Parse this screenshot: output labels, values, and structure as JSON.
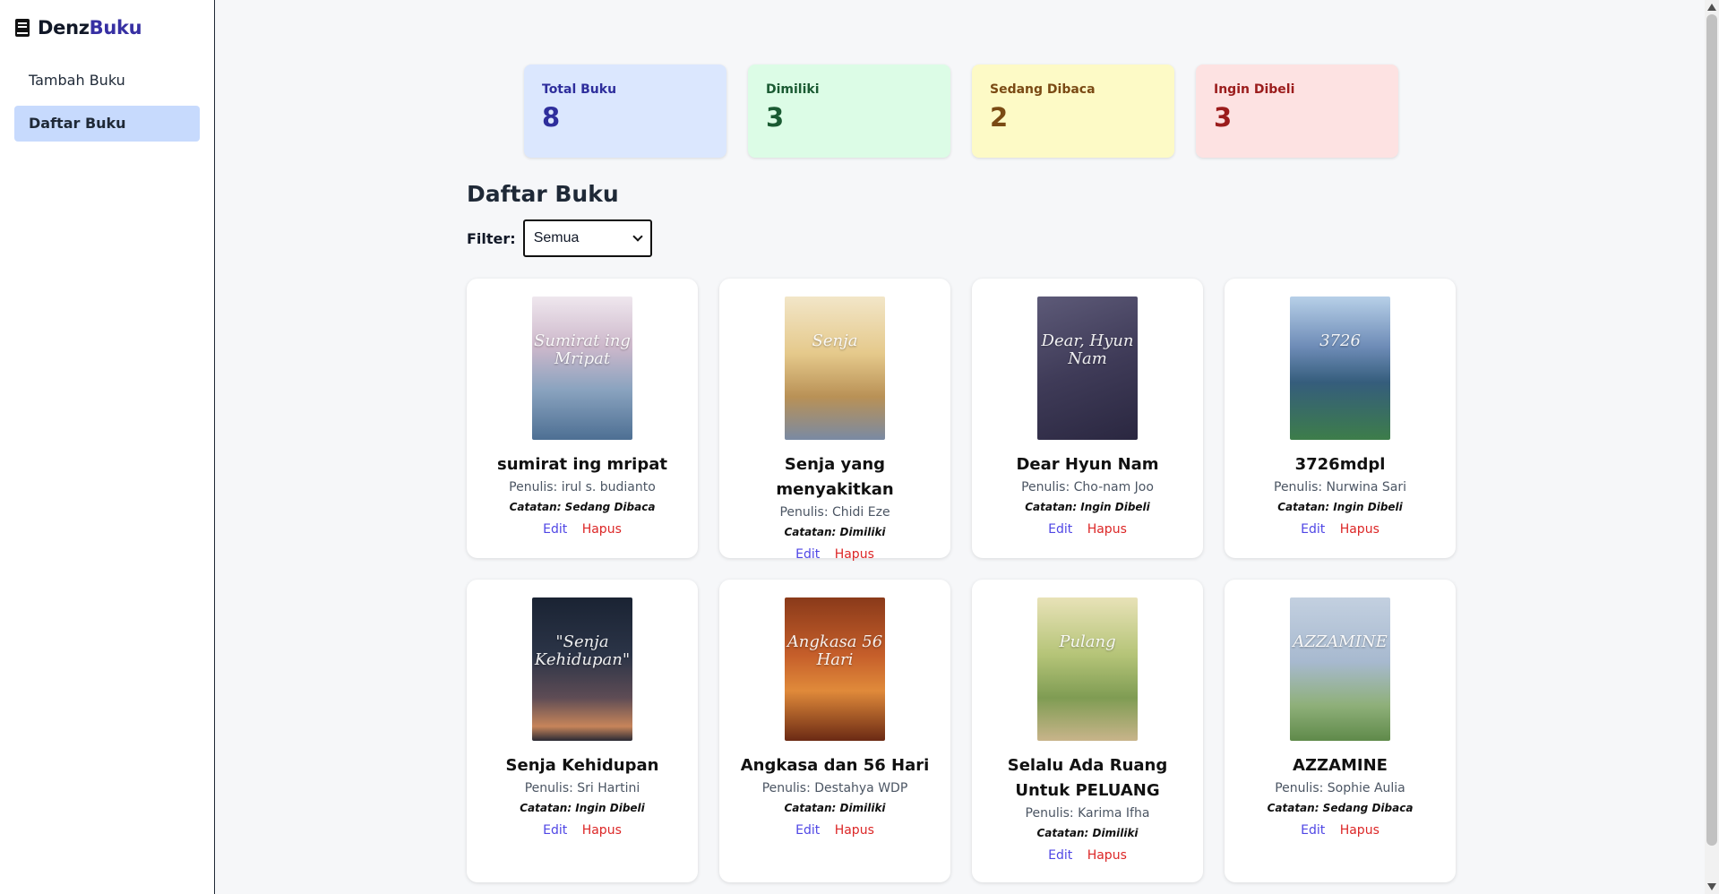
{
  "app": {
    "logo_part1": "Denz",
    "logo_part2": "Buku"
  },
  "sidebar": {
    "items": [
      {
        "label": "Tambah Buku",
        "active": false
      },
      {
        "label": "Daftar Buku",
        "active": true
      }
    ]
  },
  "stats": [
    {
      "label": "Total Buku",
      "value": "8"
    },
    {
      "label": "Dimiliki",
      "value": "3"
    },
    {
      "label": "Sedang Dibaca",
      "value": "2"
    },
    {
      "label": "Ingin Dibeli",
      "value": "3"
    }
  ],
  "main": {
    "title": "Daftar Buku",
    "filter_label": "Filter:",
    "filter_value": "Semua"
  },
  "books": [
    {
      "title": "sumirat ing mripat",
      "author": "Penulis: irul s. budianto",
      "note": "Catatan: Sedang Dibaca",
      "cover_text": "Sumirat ing Mripat"
    },
    {
      "title": "Senja yang menyakitkan",
      "author": "Penulis: Chidi Eze",
      "note": "Catatan: Dimiliki",
      "cover_text": "Senja"
    },
    {
      "title": "Dear Hyun Nam",
      "author": "Penulis: Cho-nam Joo",
      "note": "Catatan: Ingin Dibeli",
      "cover_text": "Dear, Hyun Nam"
    },
    {
      "title": "3726mdpl",
      "author": "Penulis: Nurwina Sari",
      "note": "Catatan: Ingin Dibeli",
      "cover_text": "3726"
    },
    {
      "title": "Senja Kehidupan",
      "author": "Penulis: Sri Hartini",
      "note": "Catatan: Ingin Dibeli",
      "cover_text": "\"Senja Kehidupan\""
    },
    {
      "title": "Angkasa dan 56 Hari",
      "author": "Penulis: Destahya WDP",
      "note": "Catatan: Dimiliki",
      "cover_text": "Angkasa 56 Hari"
    },
    {
      "title": "Selalu Ada Ruang Untuk PELUANG",
      "author": "Penulis: Karima Ifha",
      "note": "Catatan: Dimiliki",
      "cover_text": "Pulang"
    },
    {
      "title": "AZZAMINE",
      "author": "Penulis: Sophie Aulia",
      "note": "Catatan: Sedang Dibaca",
      "cover_text": "AZZAMINE"
    }
  ],
  "actions": {
    "edit": "Edit",
    "delete": "Hapus"
  }
}
